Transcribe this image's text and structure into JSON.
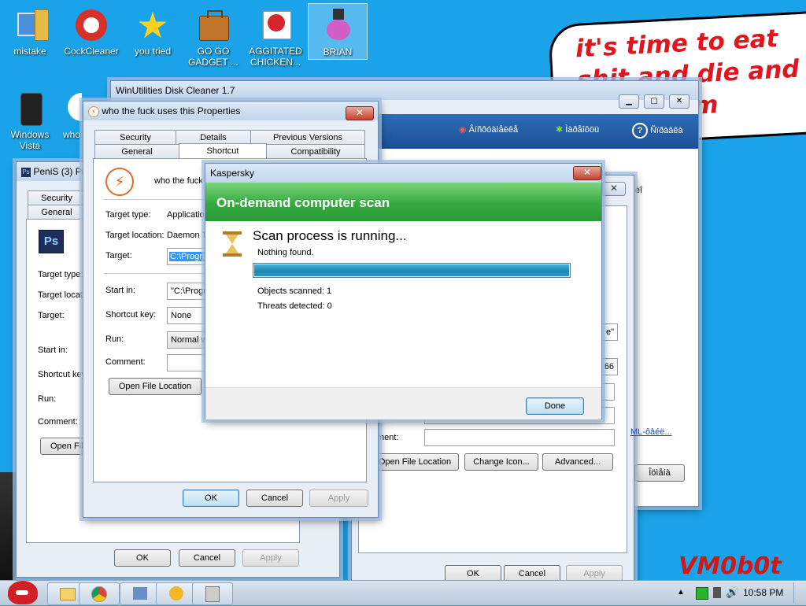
{
  "desktop": {
    "icons": [
      {
        "label": "mistake"
      },
      {
        "label": "CockCleaner"
      },
      {
        "label": "you tried"
      },
      {
        "label": "GO GO GADGET ..."
      },
      {
        "label": "AGGITATED CHICKEN..."
      },
      {
        "label": "BRIAN"
      },
      {
        "label": "Windows Vista"
      },
      {
        "label": "who"
      }
    ],
    "bubble_text": "it's time to eat shit and die and chew gum",
    "watermark": "VM0b0t"
  },
  "back_window": {
    "title": "WinUtilities Disk Cleaner 1.7",
    "toolbar": [
      "Âíñôóàìåëêå",
      "Ìàðåîôöü",
      "Ñïðàâêà"
    ],
    "side_text": "åæèî",
    "field_value_1": "e\"",
    "field_value_2": "66",
    "link_text": "ML-ôàéë...",
    "btn_extra": "Îöìåíà",
    "comment_label": "ment:",
    "open_file_location": "Open File Location",
    "change_icon": "Change Icon...",
    "advanced": "Advanced...",
    "ok": "OK",
    "cancel": "Cancel",
    "apply": "Apply"
  },
  "left_window": {
    "title": "PeniS (3) Prop",
    "tabs": [
      "Security",
      "General"
    ],
    "labels": [
      "Target type:",
      "Target locat",
      "Target:",
      "Start in:",
      "Shortcut key",
      "Run:",
      "Comment:"
    ],
    "open_file": "Open Fil",
    "ok": "OK",
    "cancel": "Cancel",
    "apply": "Apply"
  },
  "props_window": {
    "title": "who the fuck uses this Properties",
    "tabs_row1": [
      "Security",
      "Details",
      "Previous Versions"
    ],
    "tabs_row2": [
      "General",
      "Shortcut",
      "Compatibility"
    ],
    "name": "who the fuck",
    "labels": {
      "target_type": "Target type:",
      "target_location": "Target location:",
      "target": "Target:",
      "start_in": "Start in:",
      "shortcut_key": "Shortcut key:",
      "run": "Run:",
      "comment": "Comment:"
    },
    "values": {
      "target_type": "Application",
      "target_location": "Daemon T",
      "target": "C:\\Progra",
      "start_in": "\"C:\\Progr",
      "shortcut_key": "None",
      "run": "Normal w"
    },
    "open_file_location": "Open File Location",
    "ok": "OK",
    "cancel": "Cancel",
    "apply": "Apply"
  },
  "kaspersky": {
    "title": "Kaspersky",
    "banner": "On-demand computer scan",
    "heading": "Scan process is running...",
    "status": "Nothing found.",
    "progress_fraction": 1.0,
    "objects_scanned": "Objects scanned: 1",
    "threats_detected": "Threats detected: 0",
    "done": "Done"
  },
  "taskbar": {
    "clock": "10:58 PM"
  }
}
